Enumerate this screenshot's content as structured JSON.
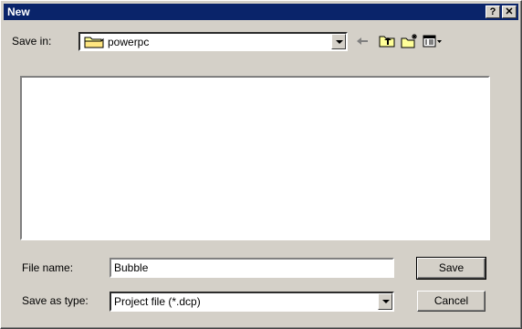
{
  "window": {
    "title": "New",
    "help_button": "?",
    "close_button": "✕"
  },
  "save_in": {
    "label": "Save in:",
    "value": "powerpc"
  },
  "toolbar": {
    "back_icon": "back-arrow-icon",
    "up_icon": "up-one-level-icon",
    "new_folder_icon": "new-folder-icon",
    "view_menu_icon": "view-menu-icon"
  },
  "file_name": {
    "label": "File name:",
    "value": "Bubble"
  },
  "save_as_type": {
    "label": "Save as type:",
    "value": "Project file (*.dcp)"
  },
  "buttons": {
    "save": "Save",
    "cancel": "Cancel"
  }
}
